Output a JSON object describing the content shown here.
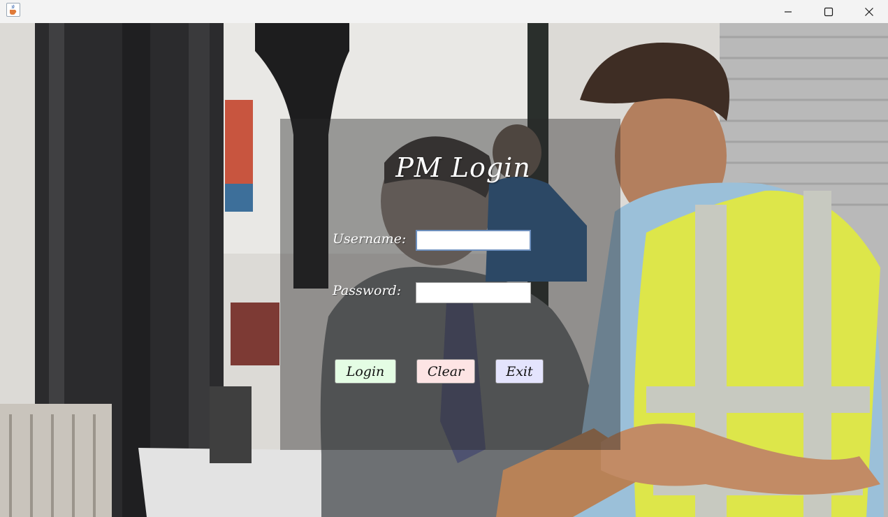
{
  "window": {
    "icon": "java-cup-icon",
    "controls": {
      "minimize": "minimize-icon",
      "maximize": "maximize-icon",
      "close": "close-icon"
    }
  },
  "login": {
    "title": "PM Login",
    "username_label": "Username:",
    "username_value": "",
    "password_label": "Password:",
    "password_value": "",
    "login_button": "Login",
    "clear_button": "Clear",
    "exit_button": "Exit"
  },
  "colors": {
    "login_button_bg": "#e4fde4",
    "clear_button_bg": "#fde4e4",
    "exit_button_bg": "#e4e4fd",
    "focused_field_border": "#6d8fbd"
  }
}
